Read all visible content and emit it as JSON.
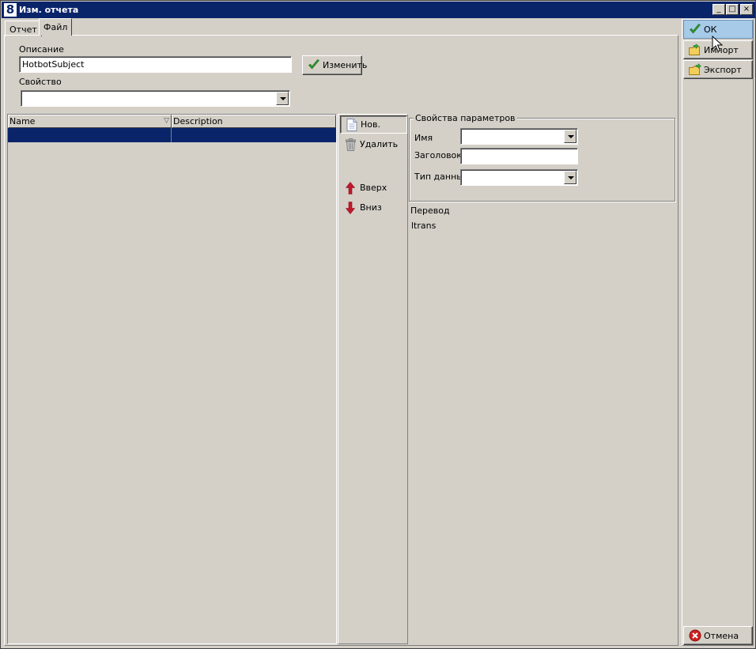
{
  "window": {
    "app_icon_text": "8",
    "title": "Изм. отчета",
    "minimize_symbol": "_",
    "maximize_symbol": "□",
    "close_symbol": "×"
  },
  "tabs": [
    {
      "label": "Отчет",
      "active": false
    },
    {
      "label": "Файл",
      "active": true
    }
  ],
  "form": {
    "description_label": "Описание",
    "description_value": "HotbotSubject",
    "change_button_label": "Изменить",
    "property_label": "Свойство",
    "property_value": ""
  },
  "grid": {
    "columns": [
      "Name",
      "Description"
    ],
    "sort_indicator": "▽",
    "rows": [
      {
        "name": "",
        "description": "",
        "selected": true
      }
    ]
  },
  "actions": {
    "new_label": "Нов.",
    "delete_label": "Удалить",
    "up_label": "Вверх",
    "down_label": "Вниз"
  },
  "param_props": {
    "group_title": "Свойства параметров",
    "name_label": "Имя",
    "name_value": "",
    "header_label": "Заголовок",
    "header_value": "",
    "datatype_label": "Тип данных",
    "datatype_value": ""
  },
  "translation": {
    "label": "Перевод",
    "value": "ltrans"
  },
  "right_toolbar": {
    "ok_label": "ОК",
    "import_label": "Импорт",
    "export_label": "Экспорт",
    "cancel_label": "Отмена"
  },
  "colors": {
    "titlebar": "#0a246a",
    "face": "#d4d0c8",
    "selection": "#0a246a",
    "hover": "#a6cae8",
    "accent_green": "#2e9a2e",
    "cancel_red": "#d02020"
  }
}
